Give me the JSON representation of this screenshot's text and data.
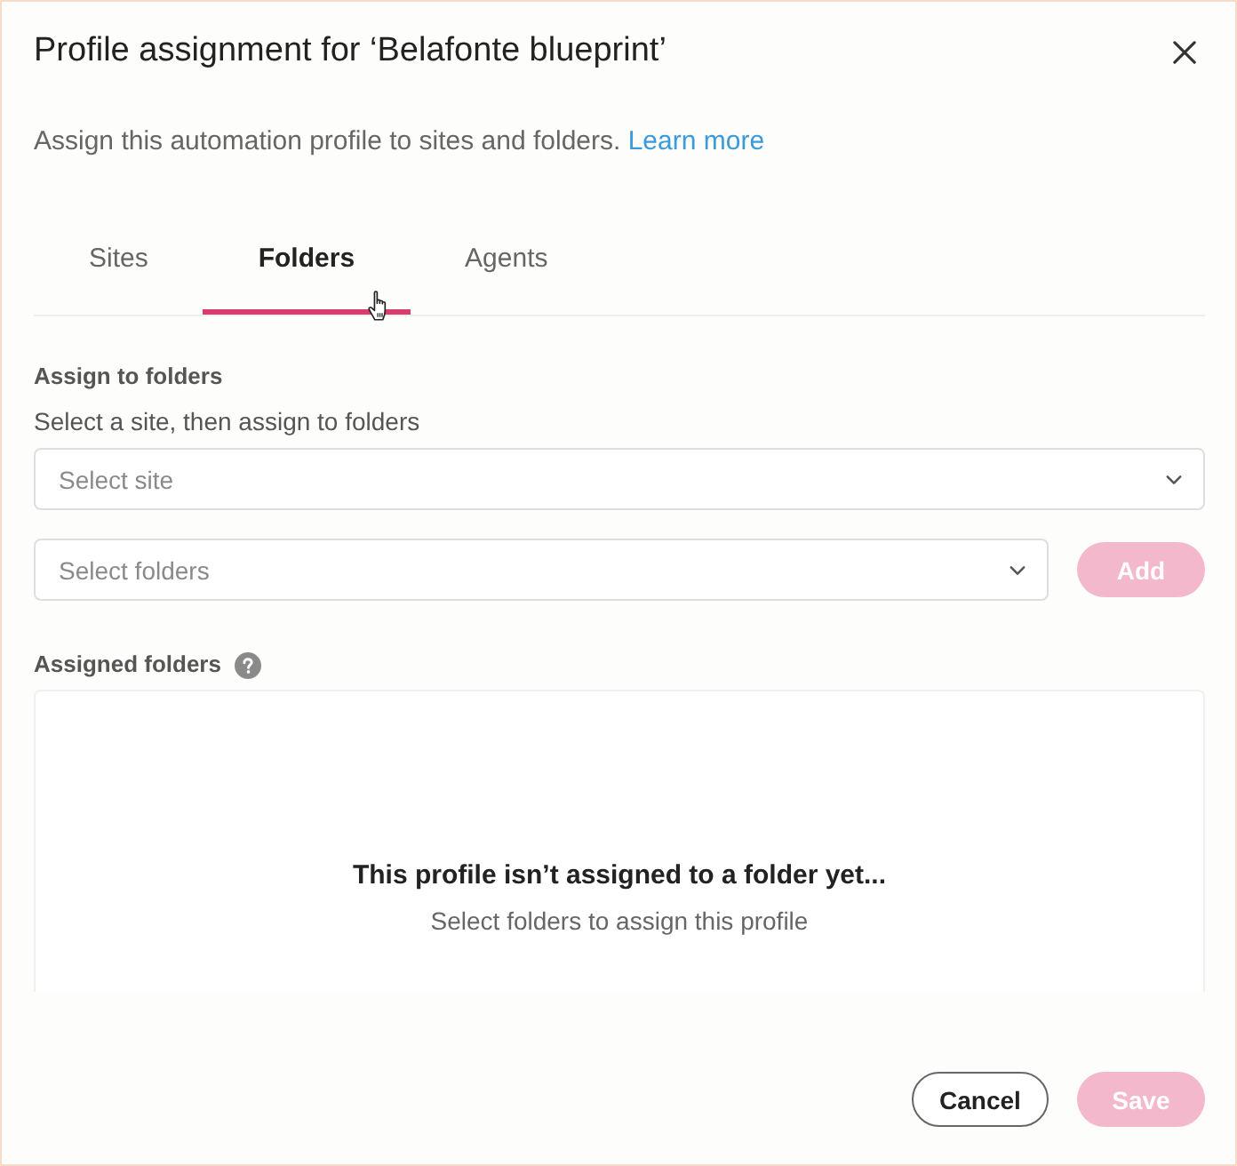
{
  "dialog": {
    "title": "Profile assignment for ‘Belafonte blueprint’",
    "description": "Assign this automation profile to sites and folders.",
    "learn_more_link": "Learn more"
  },
  "tabs": [
    {
      "label": "Sites",
      "selected": false
    },
    {
      "label": "Folders",
      "selected": true
    },
    {
      "label": "Agents",
      "selected": false
    }
  ],
  "assign_section": {
    "heading": "Assign to folders",
    "hint": "Select a site, then assign to folders",
    "site_select": {
      "placeholder": "Select site"
    },
    "folder_select": {
      "placeholder": "Select folders"
    },
    "add_button": {
      "label": "Add",
      "disabled": true
    }
  },
  "assigned_section": {
    "heading": "Assigned folders",
    "empty_title": "This profile isn’t assigned to a folder yet...",
    "empty_text": "Select folders to assign this profile"
  },
  "footer": {
    "buttons": [
      {
        "label": "Cancel",
        "kind": "secondary",
        "disabled": false
      },
      {
        "label": "Save",
        "kind": "primary",
        "disabled": true
      }
    ]
  }
}
